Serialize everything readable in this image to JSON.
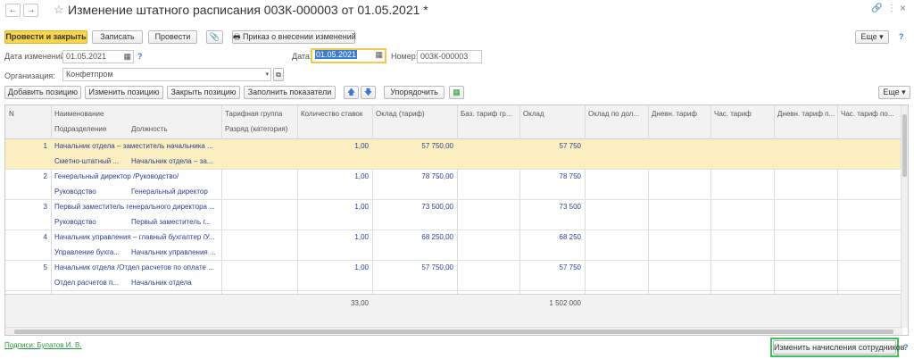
{
  "window": {
    "title": "Изменение штатного расписания 003К-000003 от 01.05.2021 *",
    "nav_back": "←",
    "nav_forward": "→",
    "more_icon": "⋮",
    "link_icon": "🔗",
    "close_icon": "×"
  },
  "toolbar": {
    "post_close": "Провести и закрыть",
    "save": "Записать",
    "post": "Провести",
    "attach_icon": "📎",
    "print_order": "Приказ о внесении изменений",
    "more": "Еще ▾",
    "help": "?"
  },
  "form": {
    "change_date_label": "Дата изменений:",
    "change_date_value": "01.05.2021",
    "help": "?",
    "date_label": "Дата:",
    "date_value": "01.05.2021",
    "number_label": "Номер:",
    "number_value": "003К-000003",
    "org_label": "Организация:",
    "org_value": "Конфетпром"
  },
  "grid_toolbar": {
    "add": "Добавить позицию",
    "edit": "Изменить позицию",
    "close": "Закрыть позицию",
    "fill": "Заполнить показатели",
    "up": "🡅",
    "down": "🡇",
    "sort": "Упорядочить",
    "more": "Еще ▾"
  },
  "grid": {
    "headers": {
      "n": "N",
      "name": "Наименование",
      "dept": "Подразделение",
      "position": "Должность",
      "tariff_group": "Тарифная группа",
      "grade": "Разряд (категория)",
      "rates": "Количество ставок",
      "salary_tariff": "Оклад (тариф)",
      "base_tariff": "Баз. тариф гр...",
      "salary": "Оклад",
      "salary_by": "Оклад по дол...",
      "daily": "Дневн. тариф",
      "hourly": "Час. тариф",
      "daily_p": "Дневн. тариф п...",
      "hourly_p": "Час. тариф по..."
    },
    "rows": [
      {
        "n": "1",
        "name": "Начальник отдела – заместитель начальника ...",
        "dept": "Сметно-штатный ...",
        "position": "Начальник отдела – за...",
        "rates": "1,00",
        "salary_tariff": "57 750,00",
        "salary": "57 750"
      },
      {
        "n": "2",
        "name": "Генеральный директор /Руководство/",
        "dept": "Руководство",
        "position": "Генеральный директор",
        "rates": "1,00",
        "salary_tariff": "78 750,00",
        "salary": "78 750"
      },
      {
        "n": "3",
        "name": "Первый заместитель генерального директора ...",
        "dept": "Руководство",
        "position": "Первый заместитель г...",
        "rates": "1,00",
        "salary_tariff": "73 500,00",
        "salary": "73 500"
      },
      {
        "n": "4",
        "name": "Начальник управления – главный бухгалтер /У...",
        "dept": "Управление бухга...",
        "position": "Начальник управления ...",
        "rates": "1,00",
        "salary_tariff": "68 250,00",
        "salary": "68 250"
      },
      {
        "n": "5",
        "name": "Начальник отдела /Отдел расчетов по оплате ...",
        "dept": "Отдел расчетов п...",
        "position": "Начальник отдела",
        "rates": "1,00",
        "salary_tariff": "57 750,00",
        "salary": "57 750"
      }
    ],
    "totals": {
      "rates": "33,00",
      "salary": "1 502 000"
    }
  },
  "footer": {
    "signatures": "Подписи: Булатов И. В.",
    "change_accruals": "Изменить начисления сотрудников",
    "help": "?"
  }
}
